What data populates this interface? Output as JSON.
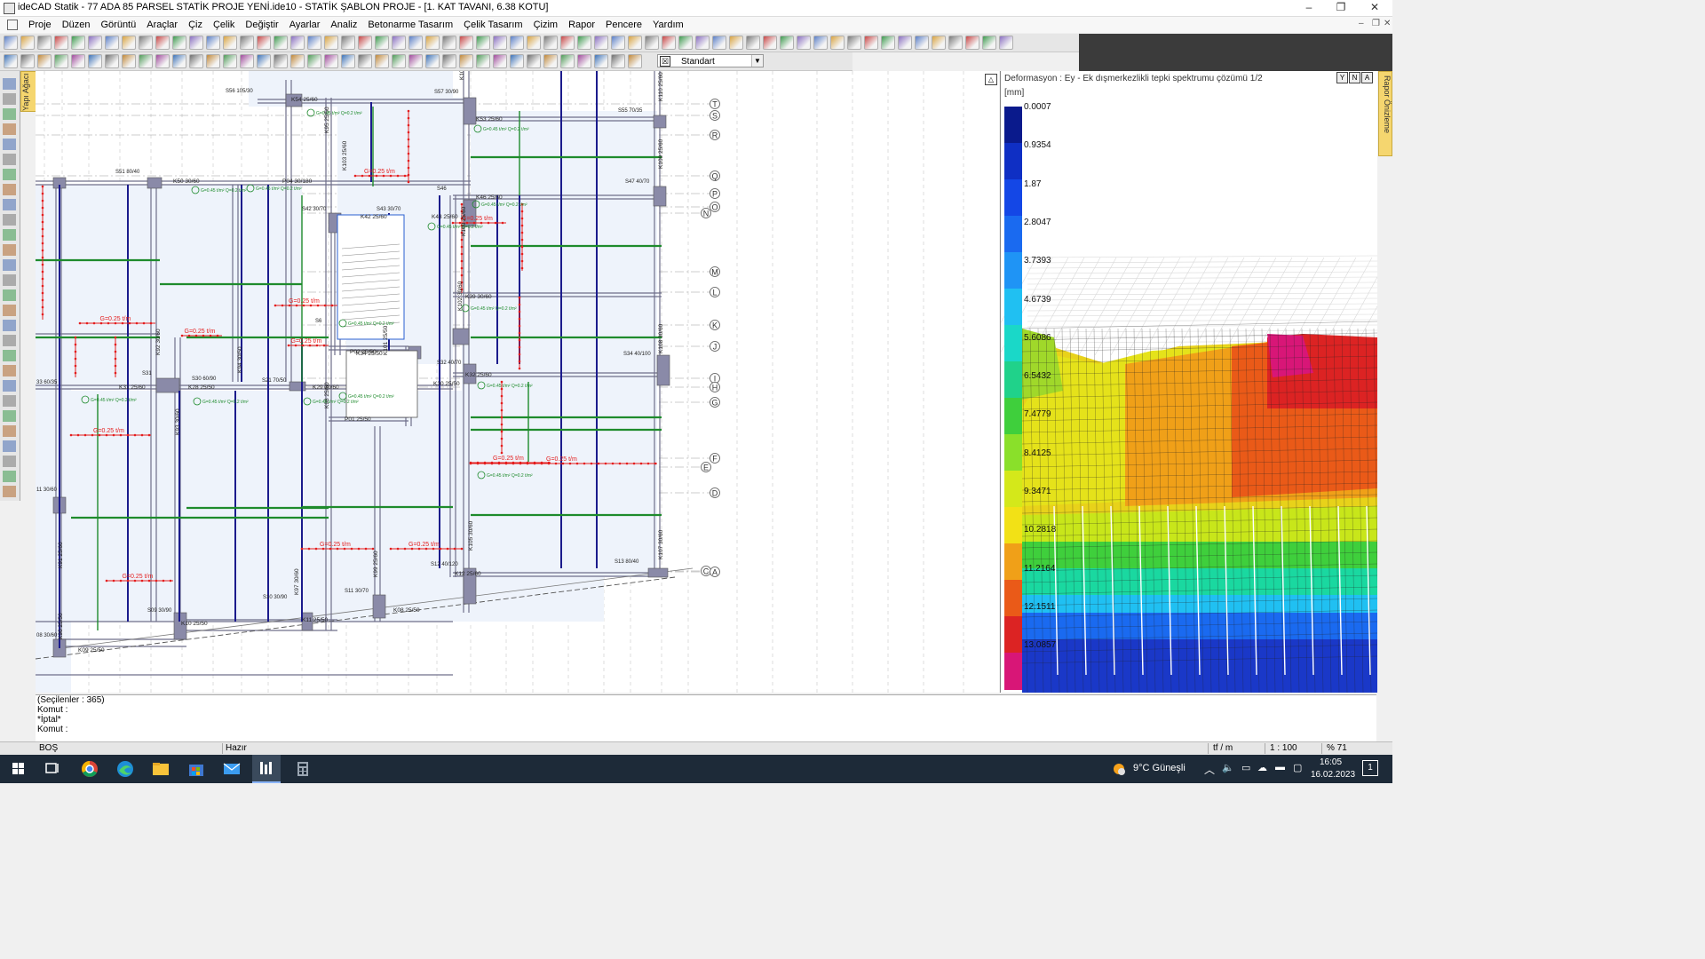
{
  "window": {
    "title": "ideCAD Statik - 77 ADA 85 PARSEL STATİK PROJE YENİ.ide10 - STATİK ŞABLON PROJE - [1. KAT TAVANI,  6.38 KOTU]",
    "controls": {
      "minimize": "–",
      "restore": "❐",
      "close": "✕"
    }
  },
  "menu": [
    "Proje",
    "Düzen",
    "Görüntü",
    "Araçlar",
    "Çiz",
    "Çelik",
    "Değiştir",
    "Ayarlar",
    "Analiz",
    "Betonarme Tasarım",
    "Çelik Tasarım",
    "Çizim",
    "Rapor",
    "Pencere",
    "Yardım"
  ],
  "toolbar": {
    "style_value": "Standart",
    "style_checked": "☒"
  },
  "side_tabs": {
    "left": "Yapı Ağacı",
    "right": "Rapor Önizleme"
  },
  "plan": {
    "axes": [
      "T",
      "S",
      "R",
      "Q",
      "P",
      "O",
      "N",
      "M",
      "L",
      "K",
      "J",
      "I",
      "H",
      "G",
      "F",
      "E",
      "D",
      "C",
      "A"
    ],
    "beams": [
      "K54 25/60",
      "K53 25/60",
      "K50 30/60",
      "P04 30/180",
      "K46 25/60",
      "K43 25/60",
      "K39 30/60",
      "K32 25/60",
      "K31 25/60",
      "K28 25/50",
      "K29 30/60",
      "K30 25/50",
      "K12 25/60",
      "K09 25/50",
      "K10 25/50",
      "K11 25/50",
      "K08 25/50",
      "P01 25/50",
      "P02 25/50",
      "K34 25/50",
      "K42 25/60"
    ],
    "slabs": [
      "S56 105/30",
      "S57 30/90",
      "S55 70/35",
      "S51 80/40",
      "S47 40/70",
      "S42 30/70",
      "S43 30/70",
      "S46",
      "S34 40/100",
      "S32 40/70",
      "S31",
      "S30 60/90",
      "S13 80/40",
      "S12 40/120",
      "S11 30/70",
      "S10 30/90",
      "S09 30/90",
      "S21 70/50",
      "S6"
    ],
    "columns": [
      "K110 25/60",
      "K109 25/60",
      "K108 30/60",
      "K107 30/60",
      "K105 30/60",
      "K104",
      "K103 25/60",
      "K102 30/60",
      "K101 25/50",
      "K100 25/60",
      "K97 30/60",
      "K98 25/50",
      "K94 30/50",
      "K93 30/60",
      "K92 30/60",
      "K91 25/60",
      "K90 25/50",
      "K95 25/50",
      "K99 25/60"
    ],
    "left_labels": [
      "33 60/35",
      "11 30/60",
      "08 30/60"
    ],
    "loads": [
      "G=0.25 t/m",
      "G=0.25 t/m",
      "G=0.25 t/m",
      "G=0.25 t/m",
      "G=0.25 t/m",
      "G=0.25 t/m",
      "G=0.25 t/m",
      "G=0.25 t/m",
      "G=0.25 t/m",
      "G=0.25 t/m",
      "G=0.25 t/m",
      "G=0.25 t/m"
    ],
    "slab_load": "G=0.45 t/m²\nQ=0.2 t/m²"
  },
  "deformation": {
    "title": "Deformasyon : Ey   -  Ek dışmerkezlikli tepki spektrumu çözümü 1/2",
    "unit": "[mm]",
    "buttons": [
      "Y",
      "N",
      "A"
    ],
    "legend_values": [
      "0.0007",
      "0.9354",
      "1.87",
      "2.8047",
      "3.7393",
      "4.6739",
      "5.6086",
      "6.5432",
      "7.4779",
      "8.4125",
      "9.3471",
      "10.2818",
      "11.2164",
      "12.1511",
      "13.0857"
    ],
    "legend_colors": [
      "#0a1a8c",
      "#0f2fc4",
      "#1447e6",
      "#1a6af0",
      "#1f94f5",
      "#20c0f2",
      "#1ad8c8",
      "#20d28a",
      "#3fcf3c",
      "#8ae02a",
      "#d4e81a",
      "#f2e116",
      "#f0a018",
      "#ea5a18",
      "#dc2323",
      "#d81677"
    ]
  },
  "command": {
    "selected": "(Seçilenler : 365)",
    "line1": "Komut :",
    "line2": "*İptal*",
    "line3": "Komut :"
  },
  "status": {
    "left": "BOŞ",
    "mid": "Hazır",
    "units": "tf / m",
    "scale": "1 : 100",
    "zoom": "% 71"
  },
  "taskbar": {
    "weather": "9°C  Güneşli",
    "time": "16:05",
    "date": "16.02.2023",
    "notif": "1"
  }
}
